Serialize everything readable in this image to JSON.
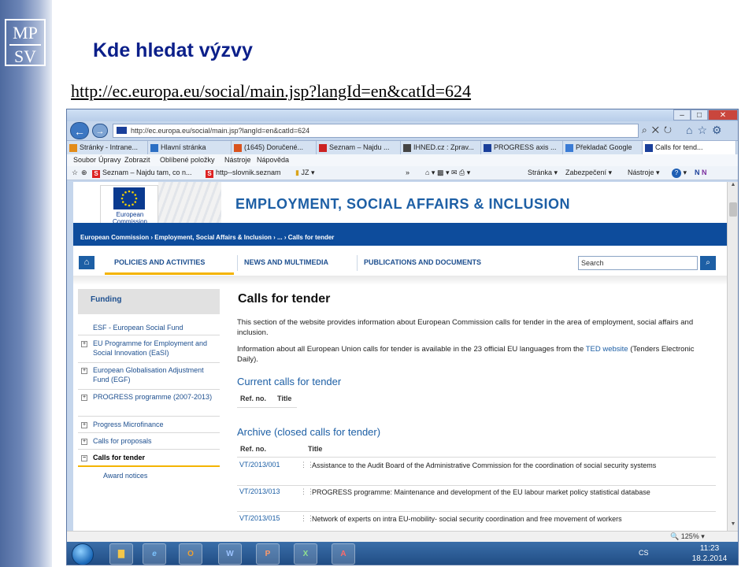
{
  "slide": {
    "title": "Kde hledat výzvy",
    "url": "http://ec.europa.eu/social/main.jsp?langId=en&catId=624",
    "logo_text": "MPSV"
  },
  "browser": {
    "window_buttons": {
      "minimize": "–",
      "maximize": "□",
      "close": "✕"
    },
    "address": "http://ec.europa.eu/social/main.jsp?langId=en&catId=624",
    "tabs": [
      {
        "label": "Stránky - Intrane...",
        "color": "#e38c1a"
      },
      {
        "label": "Hlavní stránka",
        "color": "#2b6fc4"
      },
      {
        "label": "(1645) Doručené...",
        "color": "#d9531e"
      },
      {
        "label": "Seznam – Najdu ...",
        "color": "#cc2222"
      },
      {
        "label": "IHNED.cz : Zprav...",
        "color": "#444444"
      },
      {
        "label": "PROGRESS axis ...",
        "color": "#1a3f9a"
      },
      {
        "label": "Překladač Google",
        "color": "#3a7bd5"
      },
      {
        "label": "Calls for tend...",
        "color": "#1a3f9a",
        "active": true
      }
    ],
    "menu": [
      "Soubor",
      "Úpravy",
      "Zobrazit",
      "Oblíbené položky",
      "Nástroje",
      "Nápověda"
    ],
    "favorites": [
      "Seznam – Najdu tam, co n...",
      "http--slovnik.seznam",
      "JZ"
    ],
    "command_bar": [
      "Stránka",
      "Zabezpečení",
      "Nástroje"
    ],
    "zoom": "125%"
  },
  "page": {
    "ec_logo_text": "European Commission",
    "site_title": "EMPLOYMENT, SOCIAL AFFAIRS & INCLUSION",
    "breadcrumb": "European Commission › Employment, Social Affairs & Inclusion › ... › Calls for tender",
    "nav": [
      "POLICIES AND ACTIVITIES",
      "NEWS AND MULTIMEDIA",
      "PUBLICATIONS AND DOCUMENTS"
    ],
    "search_placeholder": "Search",
    "sidebar": {
      "heading": "Funding",
      "items": [
        "ESF - European Social Fund",
        "EU Programme for Employment and Social Innovation (EaSI)",
        "European Globalisation Adjustment Fund (EGF)",
        "PROGRESS programme (2007-2013)",
        "Progress Microfinance",
        "Calls for proposals",
        "Calls for tender"
      ],
      "sub_item": "Award notices"
    },
    "content": {
      "title": "Calls for tender",
      "intro": "This section of the website provides information about European Commission calls for tender in the area of employment, social affairs and inclusion.",
      "info_before": "Information about all European Union calls for tender is available in the 23 official EU languages from the ",
      "info_link": "TED website",
      "info_after": " (Tenders Electronic Daily).",
      "current_heading": "Current calls for tender",
      "archive_heading": "Archive (closed calls for tender)",
      "col_ref": "Ref. no.",
      "col_title": "Title",
      "rows": [
        {
          "ref": "VT/2013/001",
          "title": "Assistance to the Audit Board of the Administrative Commission for the coordination of social security systems"
        },
        {
          "ref": "VT/2013/013",
          "title": "PROGRESS programme: Maintenance and development of the EU labour market policy statistical database"
        },
        {
          "ref": "VT/2013/015",
          "title": "Network of experts on intra EU-mobility- social security coordination and free movement of workers"
        }
      ]
    }
  },
  "taskbar": {
    "lang": "CS",
    "time": "11:23",
    "date": "18.2.2014"
  }
}
